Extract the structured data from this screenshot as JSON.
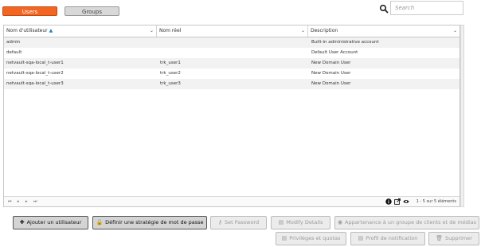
{
  "tabs": {
    "users": "Users",
    "groups": "Groups"
  },
  "search": {
    "placeholder": "Search"
  },
  "table": {
    "columns": [
      "Nom d'utilisateur",
      "Nom réel",
      "Description"
    ],
    "rows": [
      [
        "admin",
        "",
        "Built-in administrative account"
      ],
      [
        "default",
        "",
        "Default User Account"
      ],
      [
        "netvault-sqa-local_t-user1",
        "trk_user1",
        "New Domain User"
      ],
      [
        "netvault-sqa-local_t-user2",
        "trk_user2",
        "New Domain User"
      ],
      [
        "netvault-sqa-local_t-user3",
        "trk_user3",
        "New Domain User"
      ]
    ],
    "pager_text": "1 - 5 sur 5 éléments"
  },
  "buttons": {
    "add_user": "Ajouter un utilisateur",
    "password_policy": "Définir une stratégie de mot de passe",
    "set_password": "Set Password",
    "modify_details": "Modify Details",
    "group_membership": "Appartenance à un groupe de clients et de médias",
    "privileges": "Privilèges et quotas",
    "notification_profile": "Profil de notification",
    "delete": "Supprimer"
  },
  "colors": {
    "accent": "#f26522",
    "sort_arrow": "#2a7fbf"
  },
  "icons": [
    "search-icon",
    "plus-icon",
    "lock-icon",
    "info-icon",
    "external-link-icon",
    "eye-icon",
    "trash-icon"
  ]
}
